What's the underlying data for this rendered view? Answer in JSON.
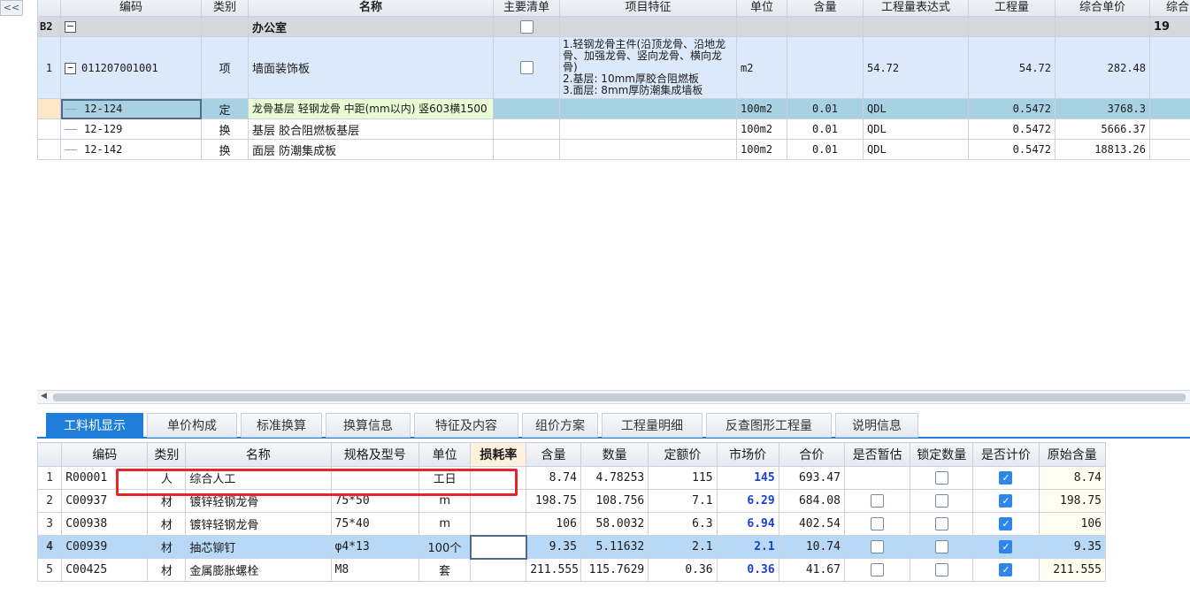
{
  "ui": {
    "collapse_label": "<<"
  },
  "upper": {
    "headers": [
      "编码",
      "类别",
      "名称",
      "主要清单",
      "项目特征",
      "单位",
      "含量",
      "工程量表达式",
      "工程量",
      "综合单价",
      "综合"
    ],
    "group": {
      "code": "B2",
      "expander": "−",
      "name": "办公室",
      "right_value": "19"
    },
    "item": {
      "index": "1",
      "expander": "−",
      "code": "011207001001",
      "type": "项",
      "name": "墙面装饰板",
      "feature": "1.轻钢龙骨主件(沿顶龙骨、沿地龙骨、加强龙骨、竖向龙骨、横向龙骨)\n2.基层: 10mm厚胶合阻燃板\n3.面层: 8mm厚防潮集成墙板",
      "unit": "m2",
      "expr": "54.72",
      "qty": "54.72",
      "price": "282.48"
    },
    "subs": [
      {
        "code": "12-124",
        "type": "定",
        "name": "龙骨基层 轻钢龙骨 中距(mm以内) 竖603横1500",
        "unit": "100m2",
        "content": "0.01",
        "expr": "QDL",
        "qty": "0.5472",
        "price": "3768.3"
      },
      {
        "code": "12-129",
        "type": "换",
        "name": "基层 胶合阻燃板基层",
        "unit": "100m2",
        "content": "0.01",
        "expr": "QDL",
        "qty": "0.5472",
        "price": "5666.37"
      },
      {
        "code": "12-142",
        "type": "换",
        "name": "面层 防潮集成板",
        "unit": "100m2",
        "content": "0.01",
        "expr": "QDL",
        "qty": "0.5472",
        "price": "18813.26"
      }
    ]
  },
  "tabs": [
    "工料机显示",
    "单价构成",
    "标准换算",
    "换算信息",
    "特征及内容",
    "组价方案",
    "工程量明细",
    "反查图形工程量",
    "说明信息"
  ],
  "lower": {
    "headers": [
      "编码",
      "类别",
      "名称",
      "规格及型号",
      "单位",
      "损耗率",
      "含量",
      "数量",
      "定额价",
      "市场价",
      "合价",
      "是否暂估",
      "锁定数量",
      "是否计价",
      "原始含量"
    ],
    "rows": [
      {
        "n": "1",
        "code": "R00001",
        "type": "人",
        "name": "综合人工",
        "spec": "",
        "unit": "工日",
        "loss": "",
        "content": "8.74",
        "qty": "4.78253",
        "base": "115",
        "market": "145",
        "total": "693.47",
        "est": false,
        "lock": false,
        "priced": true,
        "orig": "8.74"
      },
      {
        "n": "2",
        "code": "C00937",
        "type": "材",
        "name": "镀锌轻钢龙骨",
        "spec": "75*50",
        "unit": "m",
        "loss": "",
        "content": "198.75",
        "qty": "108.756",
        "base": "7.1",
        "market": "6.29",
        "total": "684.08",
        "est": false,
        "lock": false,
        "priced": true,
        "orig": "198.75"
      },
      {
        "n": "3",
        "code": "C00938",
        "type": "材",
        "name": "镀锌轻钢龙骨",
        "spec": "75*40",
        "unit": "m",
        "loss": "",
        "content": "106",
        "qty": "58.0032",
        "base": "6.3",
        "market": "6.94",
        "total": "402.54",
        "est": false,
        "lock": false,
        "priced": true,
        "orig": "106"
      },
      {
        "n": "4",
        "code": "C00939",
        "type": "材",
        "name": "抽芯铆钉",
        "spec": "φ4*13",
        "unit": "100个",
        "loss": "",
        "content": "9.35",
        "qty": "5.11632",
        "base": "2.1",
        "market": "2.1",
        "total": "10.74",
        "est": false,
        "lock": false,
        "priced": true,
        "orig": "9.35"
      },
      {
        "n": "5",
        "code": "C00425",
        "type": "材",
        "name": "金属膨胀螺栓",
        "spec": "M8",
        "unit": "套",
        "loss": "",
        "content": "211.555",
        "qty": "115.7629",
        "base": "0.36",
        "market": "0.36",
        "total": "41.67",
        "est": false,
        "lock": false,
        "priced": true,
        "orig": "211.555"
      }
    ]
  }
}
